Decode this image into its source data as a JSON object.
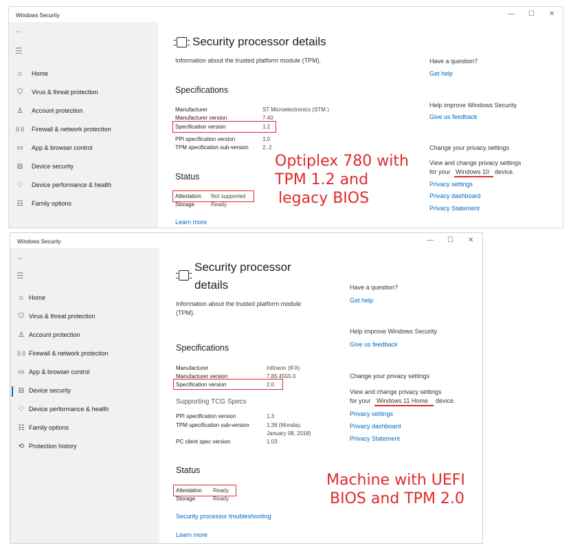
{
  "top": {
    "title": "Windows Security",
    "controls": {
      "minimize": "—",
      "maximize": "☐",
      "close": "✕"
    },
    "back_glyph": "←",
    "menu_glyph": "☰",
    "nav": [
      {
        "label": "Home",
        "icon": "home-icon"
      },
      {
        "label": "Virus & threat protection",
        "icon": "shield-icon"
      },
      {
        "label": "Account protection",
        "icon": "person-icon"
      },
      {
        "label": "Firewall & network protection",
        "icon": "wifi-icon"
      },
      {
        "label": "App & browser control",
        "icon": "window-icon"
      },
      {
        "label": "Device security",
        "icon": "laptop-icon"
      },
      {
        "label": "Device performance & health",
        "icon": "heart-icon"
      },
      {
        "label": "Family options",
        "icon": "family-icon"
      }
    ],
    "page_title": "Security processor details",
    "intro": "Information about the trusted platform module (TPM).",
    "specs_heading": "Specifications",
    "specs": [
      {
        "label": "Manufacturer",
        "value": "ST Microelectronics (STM )"
      },
      {
        "label": "Manufacturer version",
        "value": "7.40"
      },
      {
        "label": "Specification version",
        "value": "1.2"
      },
      {
        "label": "PPI specification version",
        "value": "1.0"
      },
      {
        "label": "TPM specification sub-version",
        "value": "2, 2"
      }
    ],
    "status_heading": "Status",
    "status": [
      {
        "label": "Attestation",
        "value": "Not supported"
      },
      {
        "label": "Storage",
        "value": "Ready"
      }
    ],
    "learn_more": "Learn more",
    "right": {
      "question": "Have a question?",
      "get_help": "Get help",
      "improve": "Help improve Windows Security",
      "feedback": "Give us feedback",
      "privacy_heading": "Change your privacy settings",
      "privacy_text_1": "View and change privacy settings",
      "privacy_text_2a": "for your",
      "privacy_text_2b": "Windows 10",
      "privacy_text_2c": "device.",
      "privacy_settings": "Privacy settings",
      "privacy_dashboard": "Privacy dashboard",
      "privacy_statement": "Privacy Statement"
    },
    "annotation": [
      "Optiplex 780 with",
      "TPM 1.2 and",
      "legacy BIOS"
    ]
  },
  "bottom": {
    "title": "Windows Security",
    "controls": {
      "minimize": "—",
      "maximize": "☐",
      "close": "✕"
    },
    "back_glyph": "←",
    "menu_glyph": "☰",
    "nav": [
      {
        "label": "Home",
        "icon": "home-icon"
      },
      {
        "label": "Virus & threat protection",
        "icon": "shield-icon"
      },
      {
        "label": "Account protection",
        "icon": "person-icon"
      },
      {
        "label": "Firewall & network protection",
        "icon": "wifi-icon"
      },
      {
        "label": "App & browser control",
        "icon": "window-icon"
      },
      {
        "label": "Device security",
        "icon": "laptop-icon",
        "active": true
      },
      {
        "label": "Device performance & health",
        "icon": "heart-icon"
      },
      {
        "label": "Family options",
        "icon": "family-icon"
      },
      {
        "label": "Protection history",
        "icon": "history-icon"
      }
    ],
    "page_title_1": "Security processor",
    "page_title_2": "details",
    "intro_1": "Information about the trusted platform module",
    "intro_2": "(TPM).",
    "specs_heading": "Specifications",
    "specs": [
      {
        "label": "Manufacturer",
        "value": "Infineon (IFX)"
      },
      {
        "label": "Manufacturer version",
        "value": "7.85.4555.0"
      },
      {
        "label": "Specification version",
        "value": "2.0"
      }
    ],
    "tcg_heading": "Supporting TCG Specs",
    "tcg": [
      {
        "label": "PPI specification version",
        "value": "1.3"
      },
      {
        "label": "TPM specification sub-version",
        "value": "1.38 (Monday,",
        "value2": "January 08, 2018)"
      },
      {
        "label": "PC client spec version",
        "value": "1.03"
      }
    ],
    "status_heading": "Status",
    "status": [
      {
        "label": "Attestation",
        "value": "Ready"
      },
      {
        "label": "Storage",
        "value": "Ready"
      }
    ],
    "troubleshoot": "Security processor troubleshooting",
    "learn_more": "Learn more",
    "right": {
      "question": "Have a question?",
      "get_help": "Get help",
      "improve": "Help improve Windows Security",
      "feedback": "Give us feedback",
      "privacy_heading": "Change your privacy settings",
      "privacy_text_1": "View and change privacy settings",
      "privacy_text_2a": "for your",
      "privacy_text_2b": "Windows 11 Home",
      "privacy_text_2c": "device.",
      "privacy_settings": "Privacy settings",
      "privacy_dashboard": "Privacy dashboard",
      "privacy_statement": "Privacy Statement"
    },
    "annotation": [
      "Machine with UEFI",
      "BIOS and TPM 2.0"
    ]
  },
  "colors": {
    "accent": "#0067c0",
    "annotation": "#e2282a",
    "sidebar": "#f1f1f1"
  }
}
